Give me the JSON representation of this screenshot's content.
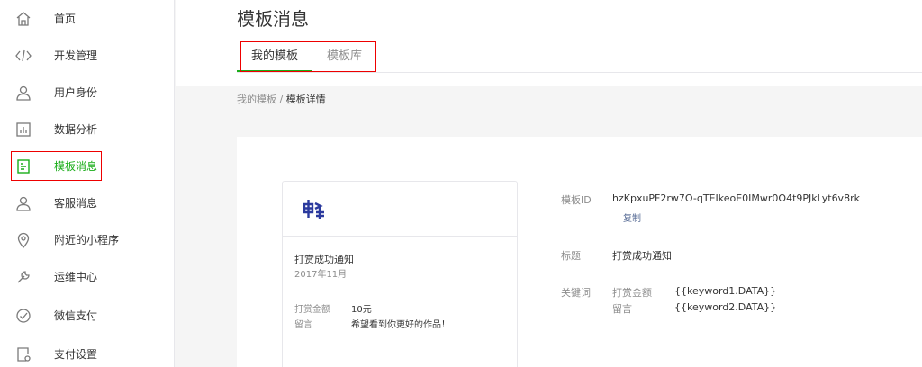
{
  "sidebar": {
    "items": [
      {
        "label": "首页",
        "icon": "home-icon"
      },
      {
        "label": "开发管理",
        "icon": "code-icon"
      },
      {
        "label": "用户身份",
        "icon": "user-icon"
      },
      {
        "label": "数据分析",
        "icon": "chart-icon"
      },
      {
        "label": "模板消息",
        "icon": "document-icon",
        "active": true
      },
      {
        "label": "客服消息",
        "icon": "support-icon"
      },
      {
        "label": "附近的小程序",
        "icon": "location-icon"
      },
      {
        "label": "运维中心",
        "icon": "wrench-icon"
      },
      {
        "label": "微信支付",
        "icon": "payment-icon"
      },
      {
        "label": "支付设置",
        "icon": "settings-doc-icon"
      }
    ]
  },
  "header": {
    "title": "模板消息",
    "tabs": [
      {
        "label": "我的模板",
        "active": true
      },
      {
        "label": "模板库",
        "active": false
      }
    ]
  },
  "breadcrumb": {
    "parent": "我的模板",
    "sep": "/",
    "current": "模板详情"
  },
  "preview": {
    "title": "打赏成功通知",
    "date": "2017年11月",
    "rows": [
      {
        "key": "打赏金额",
        "value": "10元"
      },
      {
        "key": "留言",
        "value": "希望看到你更好的作品！"
      }
    ]
  },
  "detail": {
    "template_id_label": "模板ID",
    "template_id": "hzKpxuPF2rw7O-qTEIkeoE0IMwr0O4t9PJkLyt6v8rk",
    "copy_label": "复制",
    "title_label": "标题",
    "title_value": "打赏成功通知",
    "keywords_label": "关键词",
    "keywords": [
      {
        "key": "打赏金额",
        "value": "{{keyword1.DATA}}"
      },
      {
        "key": "留言",
        "value": "{{keyword2.DATA}}"
      }
    ]
  },
  "colors": {
    "accent": "#1aad19",
    "highlight_border": "#ee0000",
    "link": "#576b95"
  }
}
